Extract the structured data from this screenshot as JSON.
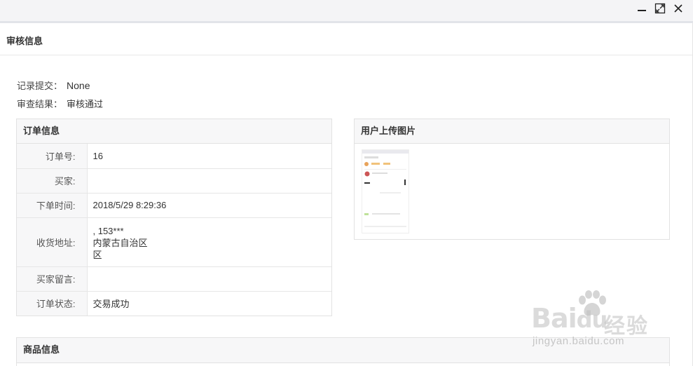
{
  "window": {
    "controls": [
      {
        "icon": "minimize-icon"
      },
      {
        "icon": "maximize-icon"
      },
      {
        "icon": "close-icon"
      }
    ]
  },
  "header": {
    "title": "审核信息"
  },
  "audit": {
    "record_submit_label": "记录提交：",
    "record_submit_value": "None",
    "review_result_label": "审查结果：",
    "review_result_value": "审核通过"
  },
  "order_panel": {
    "title": "订单信息",
    "rows": [
      {
        "label": "订单号:",
        "value": "16"
      },
      {
        "label": "买家:",
        "value": ""
      },
      {
        "label": "下单时间:",
        "value": "2018/5/29 8:29:36"
      },
      {
        "label": "收货地址:",
        "value_lines": [
          ", 153***",
          "内蒙古自治区",
          "区"
        ]
      },
      {
        "label": "买家留言:",
        "value": ""
      },
      {
        "label": "订单状态:",
        "value": "交易成功"
      }
    ]
  },
  "image_panel": {
    "title": "用户上传图片"
  },
  "goods_panel": {
    "title": "商品信息"
  },
  "watermark": {
    "brand": "Bai",
    "brand_suffix": "du",
    "cn": "经验",
    "url": "jingyan.baidu.com"
  }
}
